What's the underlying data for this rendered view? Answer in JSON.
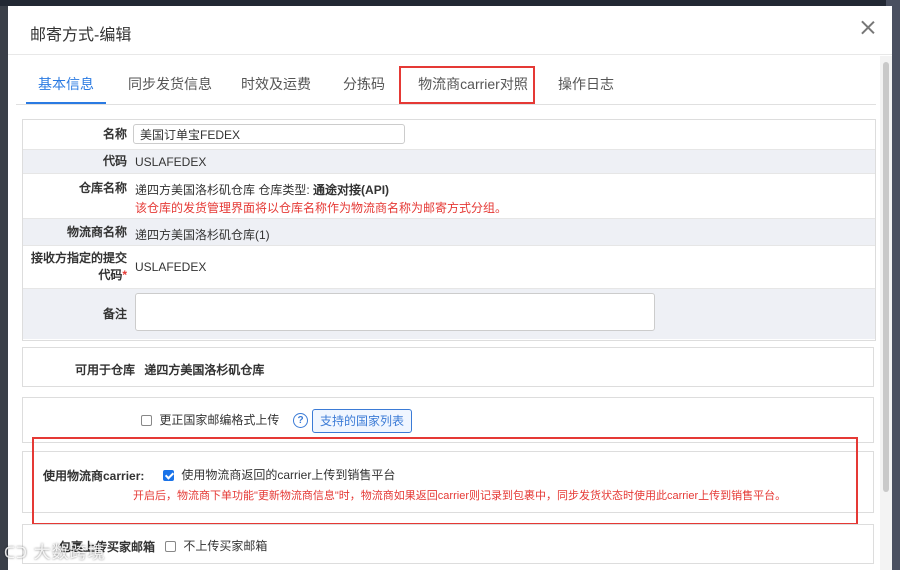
{
  "dialog": {
    "title": "邮寄方式-编辑"
  },
  "tabs": [
    {
      "label": "基本信息",
      "active": true
    },
    {
      "label": "同步发货信息"
    },
    {
      "label": "时效及运费"
    },
    {
      "label": "分拣码"
    },
    {
      "label": "物流商carrier对照"
    },
    {
      "label": "操作日志"
    }
  ],
  "form": {
    "name": {
      "label": "名称",
      "value": "美国订单宝FEDEX"
    },
    "code": {
      "label": "代码",
      "value": "USLAFEDEX"
    },
    "warehouse": {
      "label": "仓库名称",
      "value": "递四方美国洛杉矶仓库",
      "type_label": "仓库类型:",
      "type_value": "通途对接(API)",
      "note": "该仓库的发货管理界面将以仓库名称作为物流商名称为邮寄方式分组。"
    },
    "carrier_name": {
      "label": "物流商名称",
      "value": "递四方美国洛杉矶仓库(1)"
    },
    "receiver_code": {
      "label": "接收方指定的提交代码",
      "required_mark": "*",
      "value": "USLAFEDEX"
    },
    "remark": {
      "label": "备注",
      "value": ""
    }
  },
  "available_warehouse": {
    "label": "可用于仓库",
    "value": "递四方美国洛杉矶仓库"
  },
  "country_code": {
    "checkbox_label": "更正国家邮编格式上传",
    "button_label": "支持的国家列表",
    "help_icon": "?"
  },
  "use_carrier": {
    "label": "使用物流商carrier:",
    "checkbox_label": "使用物流商返回的carrier上传到销售平台",
    "note": "开启后，物流商下单功能\"更新物流商信息\"时，物流商如果返回carrier则记录到包裹中，同步发货状态时使用此carrier上传到销售平台。"
  },
  "buyer_email": {
    "label": "包裹上传买家邮箱",
    "checkbox_label": "不上传买家邮箱"
  },
  "watermark": {
    "text": "大数跨境"
  },
  "colors": {
    "accent": "#2a7ae2",
    "highlight": "#e53935",
    "note_red": "#e53935"
  }
}
